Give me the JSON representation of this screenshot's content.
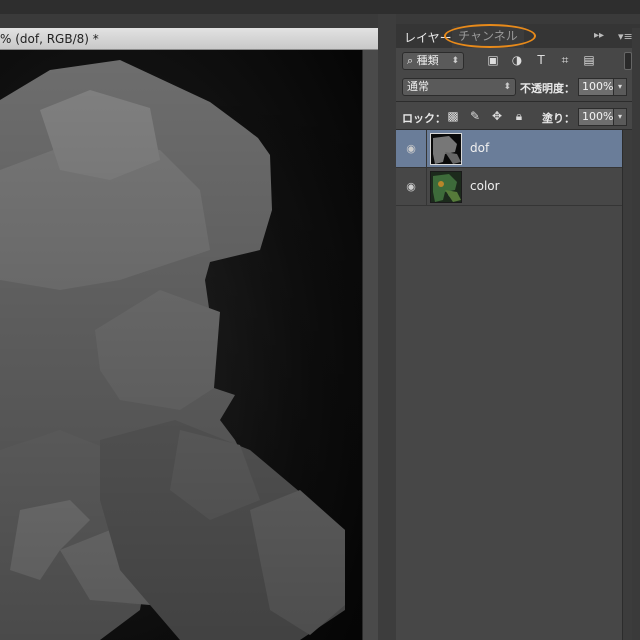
{
  "document": {
    "tab_title": "% (dof, RGB/8) *"
  },
  "panel": {
    "tabs": [
      {
        "label": "レイヤー",
        "active": true
      },
      {
        "label": "チャンネル",
        "active": false,
        "highlighted": true
      }
    ],
    "highlight_color": "#e88a1a",
    "filter": {
      "label": "種類",
      "icons": [
        "image-filter-icon",
        "adjustment-filter-icon",
        "type-filter-icon",
        "shape-filter-icon",
        "smartobject-filter-icon"
      ]
    },
    "blend_mode": "通常",
    "opacity_label": "不透明度：",
    "opacity_value": "100%",
    "lock_label": "ロック：",
    "lock_icons": [
      "lock-transparency-icon",
      "lock-image-icon",
      "lock-position-icon",
      "lock-all-icon"
    ],
    "fill_label": "塗り：",
    "fill_value": "100%",
    "layers": [
      {
        "name": "dof",
        "visible": true,
        "selected": true
      },
      {
        "name": "color",
        "visible": true,
        "selected": false
      }
    ],
    "selected_row_color": "#6a7d99"
  }
}
